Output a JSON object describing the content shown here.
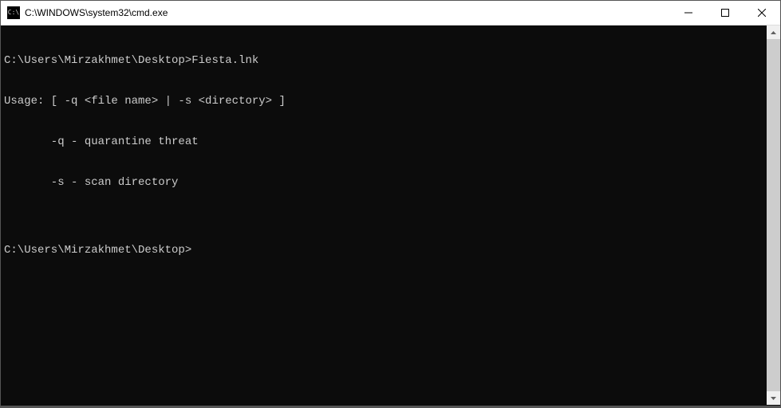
{
  "window": {
    "title": "C:\\WINDOWS\\system32\\cmd.exe",
    "icon_label": "cmd-icon"
  },
  "console": {
    "lines": [
      "C:\\Users\\Mirzakhmet\\Desktop>Fiesta.lnk",
      "Usage: [ -q <file name> | -s <directory> ]",
      "       -q - quarantine threat",
      "       -s - scan directory",
      "",
      "C:\\Users\\Mirzakhmet\\Desktop>"
    ]
  },
  "colors": {
    "console_bg": "#0c0c0c",
    "console_fg": "#cccccc",
    "titlebar_bg": "#ffffff"
  }
}
